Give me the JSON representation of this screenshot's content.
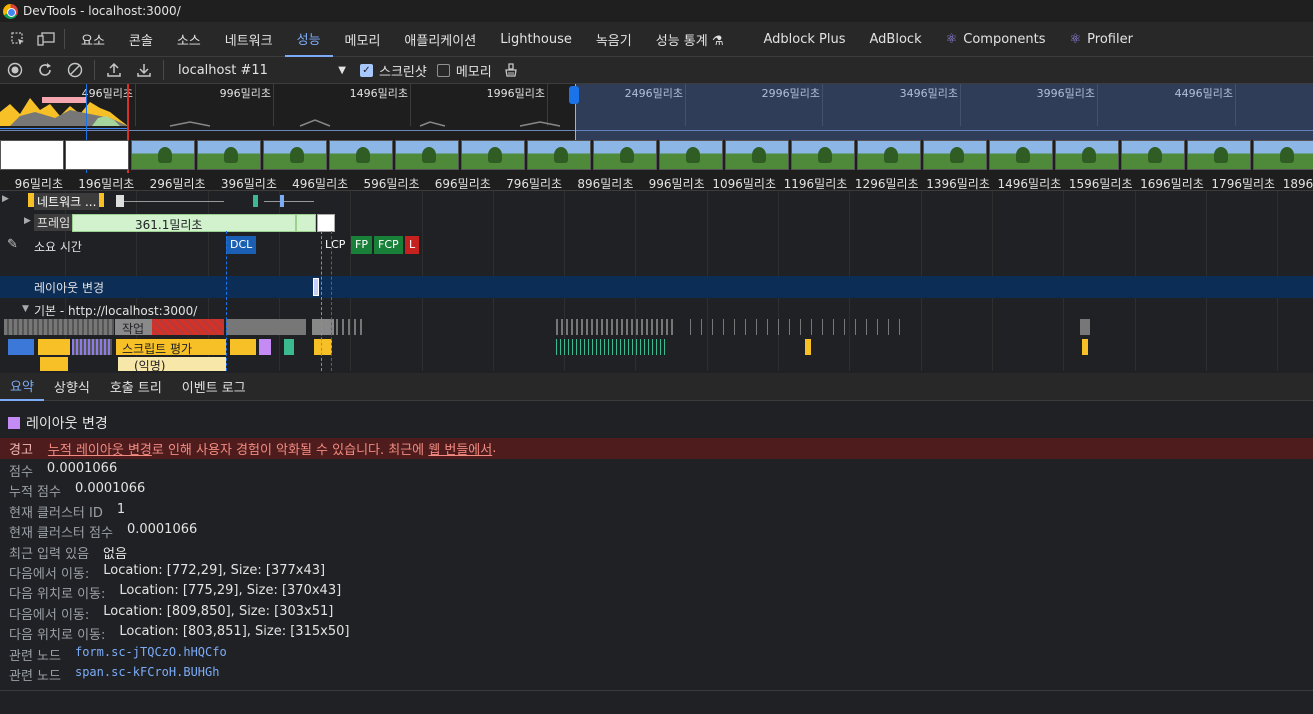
{
  "window": {
    "title": "DevTools - localhost:3000/"
  },
  "main_tabs": [
    "요소",
    "콘솔",
    "소스",
    "네트워크",
    "성능",
    "메모리",
    "애플리케이션",
    "Lighthouse",
    "녹음기",
    "성능 통계 ⚗",
    "Adblock Plus",
    "AdBlock",
    "Components",
    "Profiler"
  ],
  "active_main_tab": "성능",
  "perf_toolbar": {
    "target": "localhost #11",
    "screenshot_label": "스크린샷",
    "screenshot_checked": true,
    "memory_label": "메모리",
    "memory_checked": false
  },
  "overview": {
    "labels": [
      "496밀리초",
      "996밀리초",
      "1496밀리초",
      "1996밀리초",
      "2496밀리초",
      "2996밀리초",
      "3496밀리초",
      "3996밀리초",
      "4496밀리초"
    ]
  },
  "ruler": {
    "labels": [
      "96밀리초",
      "196밀리초",
      "296밀리초",
      "396밀리초",
      "496밀리초",
      "596밀리초",
      "696밀리초",
      "796밀리초",
      "896밀리초",
      "996밀리초",
      "1096밀리초",
      "1196밀리초",
      "1296밀리초",
      "1396밀리초",
      "1496밀리초",
      "1596밀리초",
      "1696밀리초",
      "1796밀리초",
      "1896밀리초"
    ]
  },
  "tracks": {
    "network": "네트워크 ...",
    "frames": "프레임",
    "frame_duration": "361.1밀리초",
    "timings": "소요 시간",
    "markers": [
      "DCL",
      "LCP",
      "FP",
      "FCP",
      "L"
    ],
    "layout_shifts": "레이아웃 변경",
    "main_thread": "기본 - http://localhost:3000/",
    "task": "작업",
    "script_eval": "스크립트 평가",
    "anonymous": "(익명)"
  },
  "detail_tabs": [
    "요약",
    "상향식",
    "호출 트리",
    "이벤트 로그"
  ],
  "active_detail_tab": "요약",
  "summary": {
    "title": "레이아웃 변경",
    "warning_label": "경고",
    "warning_link": "누적 레이아웃 변경",
    "warning_text": "로 인해 사용자 경험이 악화될 수 있습니다. 최근에 ",
    "warning_link2": "웹 번들에서",
    "warning_end": ".",
    "rows": [
      {
        "k": "점수",
        "v": "0.0001066"
      },
      {
        "k": "누적 점수",
        "v": "0.0001066"
      },
      {
        "k": "현재 클러스터 ID",
        "v": "1"
      },
      {
        "k": "현재 클러스터 점수",
        "v": "0.0001066"
      },
      {
        "k": "최근 입력 있음",
        "v": "없음"
      },
      {
        "k": "다음에서 이동:",
        "v": "Location: [772,29], Size: [377x43]"
      },
      {
        "k": "다음 위치로 이동:",
        "v": "Location: [775,29], Size: [370x43]"
      },
      {
        "k": "다음에서 이동:",
        "v": "Location: [809,850], Size: [303x51]"
      },
      {
        "k": "다음 위치로 이동:",
        "v": "Location: [803,851], Size: [315x50]"
      },
      {
        "k": "관련 노드",
        "v": "form.sc-jTQCzO.hHQCfo",
        "node": true
      },
      {
        "k": "관련 노드",
        "v": "span.sc-kFCroH.BUHGh",
        "node": true
      }
    ]
  }
}
